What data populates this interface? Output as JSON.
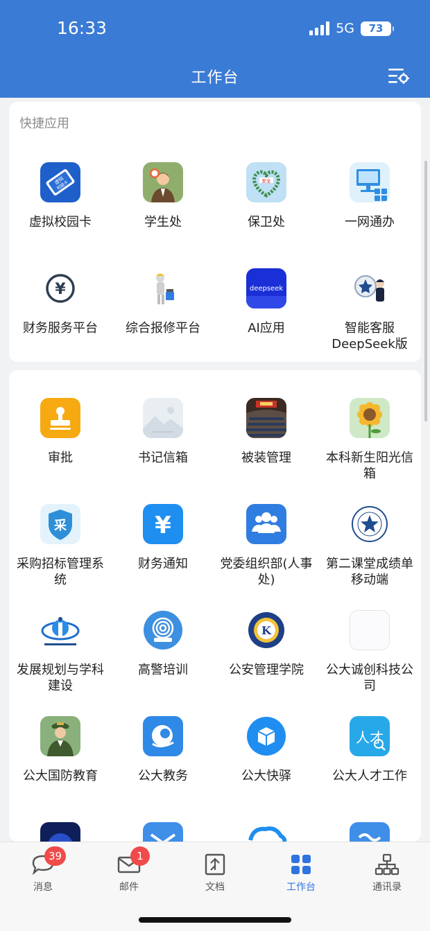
{
  "status_bar": {
    "time": "16:33",
    "network": "5G",
    "battery": "73"
  },
  "header": {
    "title": "工作台",
    "settings_icon": "settings-list-icon"
  },
  "quick_apps": {
    "title": "快捷应用",
    "items": [
      {
        "label": "虚拟校园卡",
        "icon": "virtual-campus-card-icon",
        "icon_text": "虚拟 校园卡"
      },
      {
        "label": "学生处",
        "icon": "student-affairs-icon"
      },
      {
        "label": "保卫处",
        "icon": "security-office-icon",
        "icon_text": "安全"
      },
      {
        "label": "一网通办",
        "icon": "one-stop-service-icon"
      },
      {
        "label": "财务服务平台",
        "icon": "finance-platform-icon"
      },
      {
        "label": "综合报修平台",
        "icon": "repair-platform-icon"
      },
      {
        "label": "AI应用",
        "icon": "ai-app-icon",
        "icon_text": "deepseek"
      },
      {
        "label": "智能客服DeepSeek版",
        "icon": "smart-support-icon"
      }
    ]
  },
  "apps": {
    "items": [
      {
        "label": "审批",
        "icon": "approval-stamp-icon"
      },
      {
        "label": "书记信箱",
        "icon": "image-placeholder-icon"
      },
      {
        "label": "被装管理",
        "icon": "auditorium-photo-icon"
      },
      {
        "label": "本科新生阳光信箱",
        "icon": "sunflower-icon"
      },
      {
        "label": "采购招标管理系统",
        "icon": "procurement-icon",
        "icon_text": "采"
      },
      {
        "label": "财务通知",
        "icon": "yuan-icon"
      },
      {
        "label": "党委组织部(人事处)",
        "icon": "people-group-icon"
      },
      {
        "label": "第二课堂成绩单移动端",
        "icon": "police-emblem-icon"
      },
      {
        "label": "发展规划与学科建设",
        "icon": "development-planning-icon"
      },
      {
        "label": "高警培训",
        "icon": "training-icon"
      },
      {
        "label": "公安管理学院",
        "icon": "college-emblem-icon",
        "icon_text": "K"
      },
      {
        "label": "公大诚创科技公司",
        "icon": "blank-app-icon"
      },
      {
        "label": "公大国防教育",
        "icon": "soldier-icon"
      },
      {
        "label": "公大教务",
        "icon": "academic-affairs-icon"
      },
      {
        "label": "公大快驿",
        "icon": "parcel-box-icon"
      },
      {
        "label": "公大人才工作",
        "icon": "talent-icon",
        "icon_text": "人才"
      },
      {
        "label": "",
        "icon": "dark-globe-icon"
      },
      {
        "label": "",
        "icon": "mail-app-icon"
      },
      {
        "label": "",
        "icon": "cloud-app-icon"
      },
      {
        "label": "",
        "icon": "wave-app-icon"
      }
    ]
  },
  "tabbar": {
    "items": [
      {
        "label": "消息",
        "icon": "chat-bubble-icon",
        "badge": "39"
      },
      {
        "label": "邮件",
        "icon": "mail-icon",
        "badge": "1"
      },
      {
        "label": "文档",
        "icon": "document-icon"
      },
      {
        "label": "工作台",
        "icon": "workbench-grid-icon",
        "active": true
      },
      {
        "label": "通讯录",
        "icon": "org-chart-icon"
      }
    ]
  },
  "colors": {
    "header_blue": "#3a7bd5",
    "accent_blue": "#2f73e0",
    "badge_red": "#f04a4a"
  }
}
